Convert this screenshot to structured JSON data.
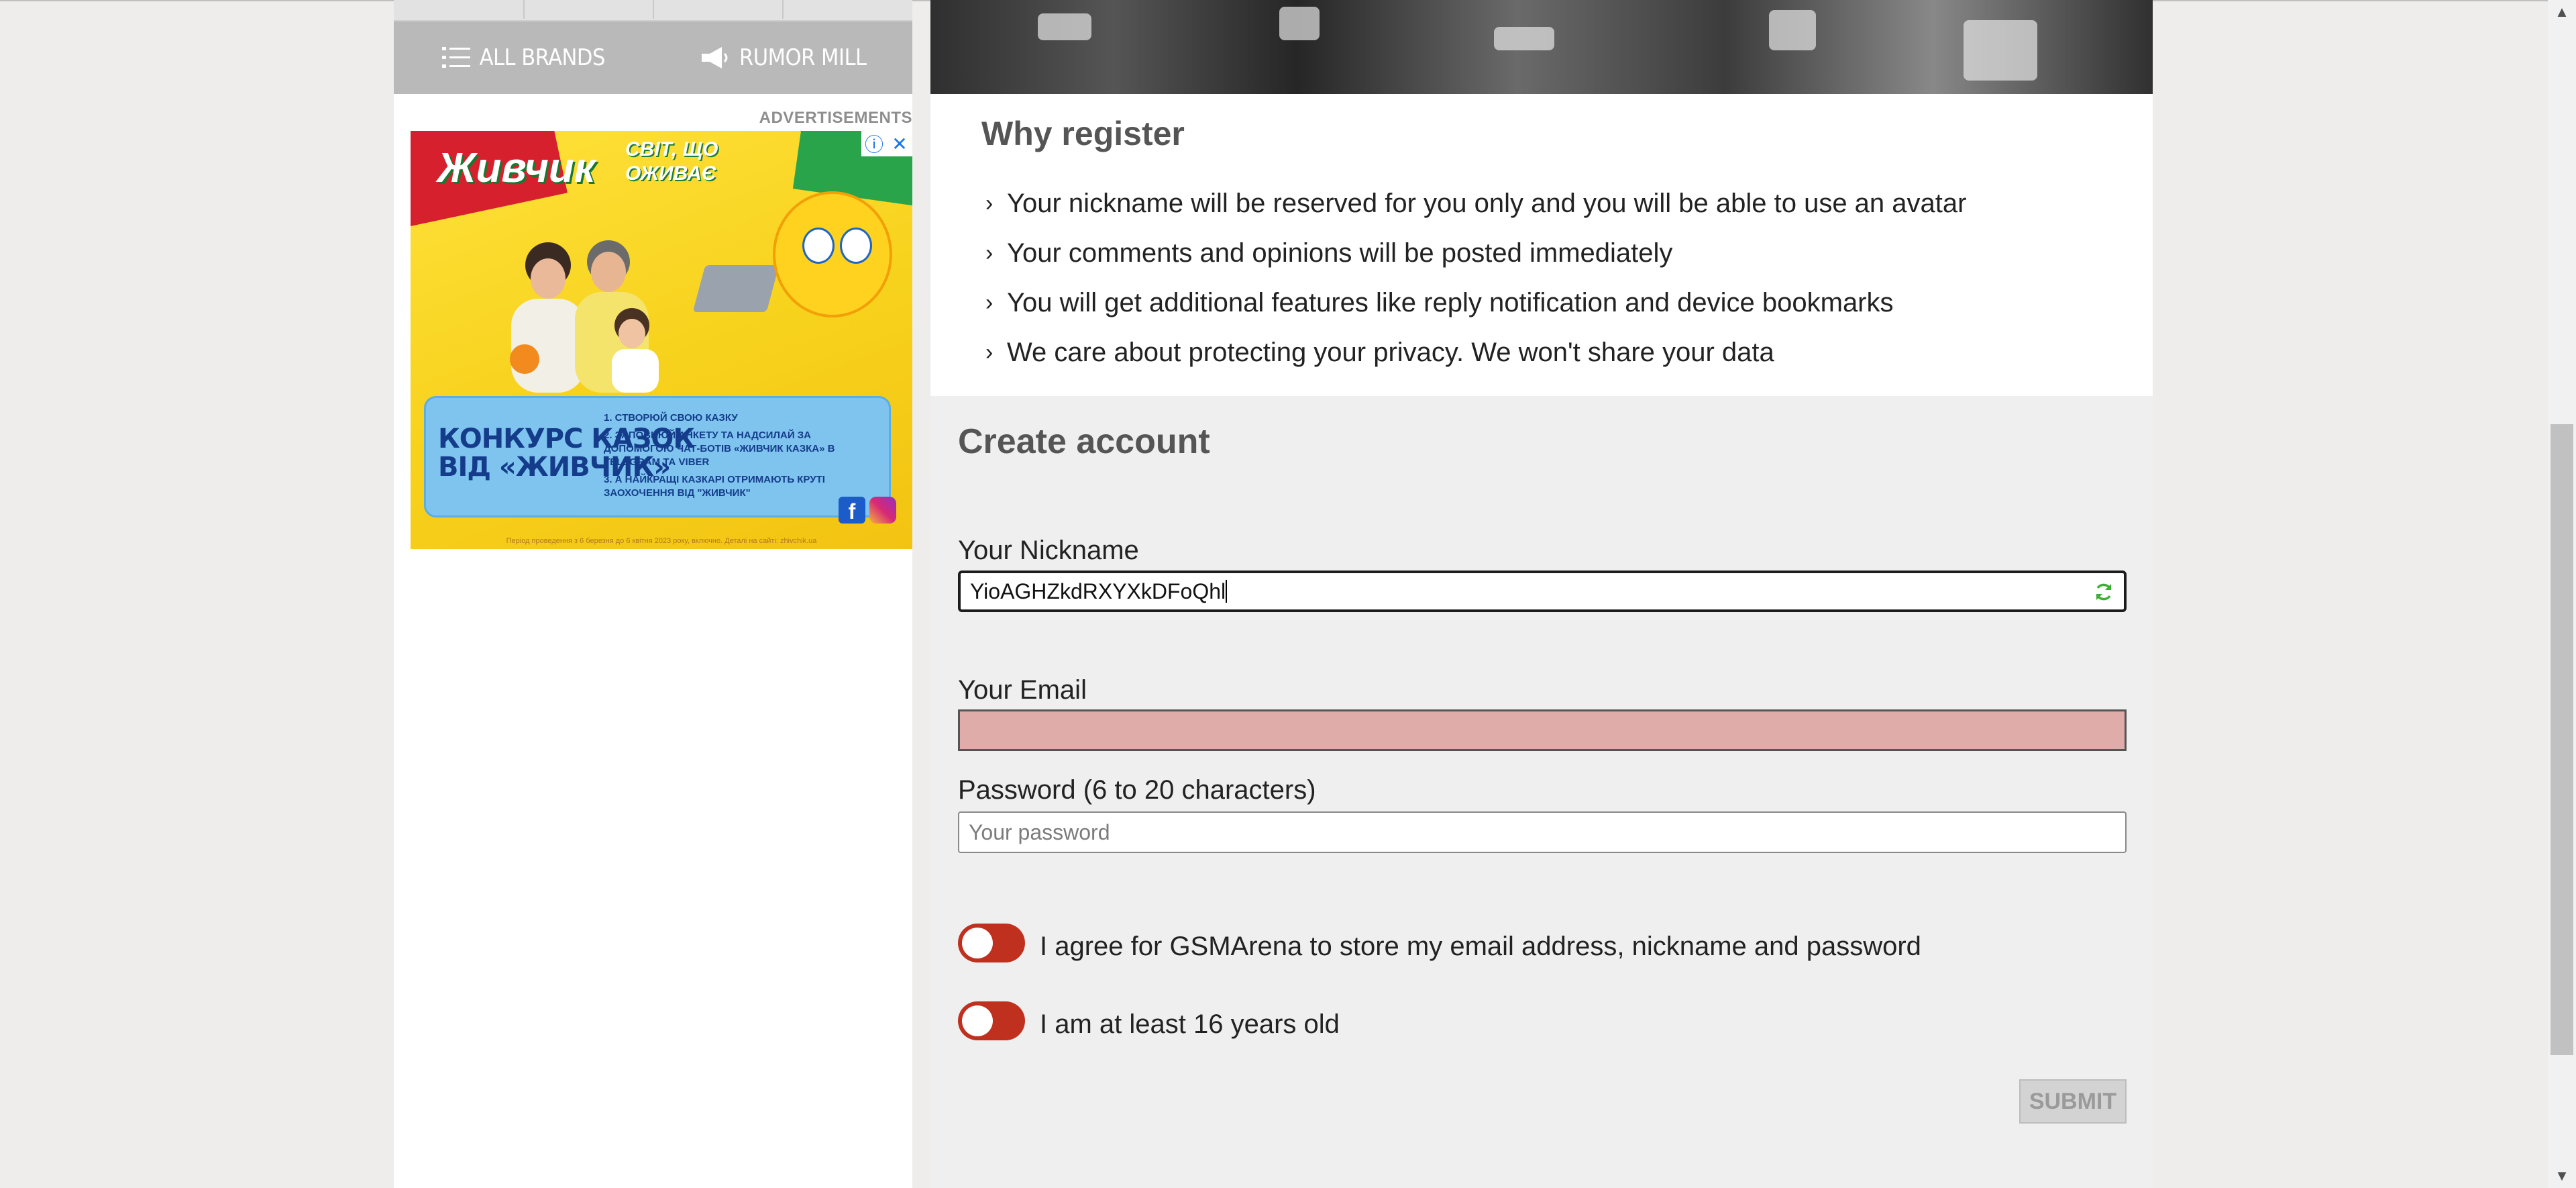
{
  "sidebar": {
    "nav": {
      "all_brands": "ALL BRANDS",
      "rumor_mill": "RUMOR MILL"
    },
    "ads_label": "ADVERTISEMENTS",
    "ad": {
      "brand": "Живчик",
      "slogan_line1": "СВІТ, ЩО",
      "slogan_line2": "ОЖИВАЄ",
      "headline_line1": "КОНКУРС КАЗОК",
      "headline_line2": "ВІД «ЖИВЧИК»",
      "step1": "1. СТВОРЮЙ СВОЮ КАЗКУ",
      "step2": "2. ЗАПОВНЮЙ АНКЕТУ ТА НАДСИЛАЙ ЗА ДОПОМОГОЮ ЧАТ-БОТІВ «ЖИВЧИК КАЗКА» В TELEGRAM ТА VIBER",
      "step3": "3. А НАЙКРАЩІ КАЗКАРІ ОТРИМАЮТЬ КРУТІ ЗАОХОЧЕННЯ ВІД \"ЖИВЧИК\"",
      "fine_print": "Період проведення з 6 березня до 6 квітня 2023 року, включно. Деталі на сайті: zhivchik.ua"
    }
  },
  "why_register": {
    "title": "Why register",
    "items": [
      "Your nickname will be reserved for you only and you will be able to use an avatar",
      "Your comments and opinions will be posted immediately",
      "You will get additional features like reply notification and device bookmarks",
      "We care about protecting your privacy. We won't share your data"
    ]
  },
  "create_account": {
    "title": "Create account",
    "nickname_label": "Your Nickname",
    "nickname_value": "YioAGHZkdRXYXkDFoQhl",
    "email_label": "Your Email",
    "email_value": "",
    "password_label": "Password (6 to 20 characters)",
    "password_placeholder": "Your password",
    "agree_store_label": "I agree for GSMArena to store my email address, nickname and password",
    "age_label": "I am at least 16 years old",
    "submit_label": "SUBMIT"
  },
  "colors": {
    "toggle_off": "#c0301f",
    "email_error_bg": "#e0acaa",
    "refresh_icon": "#3cb034"
  }
}
